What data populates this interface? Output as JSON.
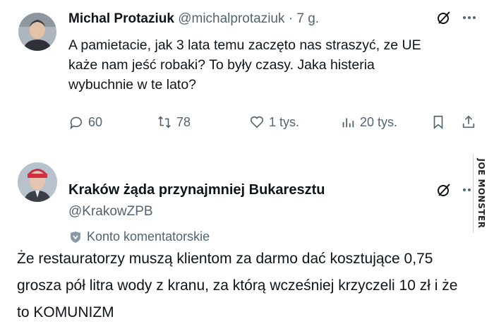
{
  "tweet": {
    "author_name": "Michal Protaziuk",
    "author_handle": "@michalprotaziuk",
    "separator": "·",
    "time": "7 g.",
    "text": "A pamietacie, jak 3 lata temu zaczęto nas straszyć, ze UE każe nam jeść robaki? To były czasy. Jaka histeria wybuchnie w te lato?",
    "actions": {
      "replies": "60",
      "retweets": "78",
      "likes": "1 tys.",
      "views": "20 tys."
    }
  },
  "reply": {
    "author_name": "Kraków żąda przynajmniej Bukaresztu",
    "author_handle": "@KrakowZPB",
    "account_label": "Konto komentatorskie",
    "text": "Że restauratorzy muszą klientom za darmo dać kosztujące 0,75 grosza pół litra wody z kranu, za którą wcześniej krzyczeli 10 zł i że to KOMUNIZM"
  },
  "watermark": "JOE MONSTER",
  "icons": [
    "grok-icon",
    "more-icon",
    "reply-icon",
    "retweet-icon",
    "like-icon",
    "views-icon",
    "bookmark-icon",
    "share-icon",
    "shield-icon"
  ],
  "colors": {
    "text": "#0f1419",
    "secondary": "#536471",
    "background": "#ffffff"
  }
}
